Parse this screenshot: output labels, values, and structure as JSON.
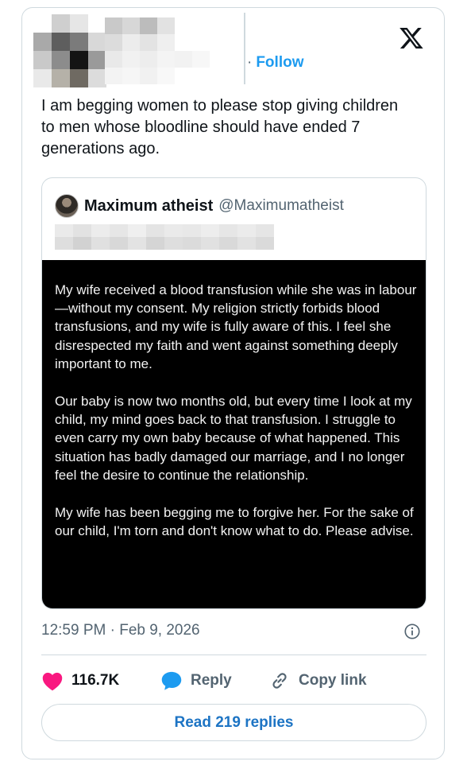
{
  "follow_label": "Follow",
  "tweet_text": "I am begging women to please stop giving children to men whose bloodline should have ended 7 generations ago.",
  "quote": {
    "name": "Maximum atheist",
    "handle": "@Maximumatheist",
    "image_paragraphs": [
      "My wife received a blood transfusion while she was in labour—without my consent. My religion strictly forbids blood transfusions, and my wife is fully aware of this. I feel she disrespected my faith and went against something deeply important to me.",
      "Our baby is now two months old, but every time I look at my child, my mind goes back to that transfusion. I struggle to even carry my own baby because of what happened. This situation has badly damaged our marriage, and I no longer feel the desire to continue the relationship.",
      "My wife has been begging me to forgive her. For the sake of our child, I'm torn and don't know what to do. Please advise."
    ]
  },
  "timestamp": "12:59 PM · Feb 9, 2026",
  "actions": {
    "like_count": "116.7K",
    "reply_label": "Reply",
    "copy_link_label": "Copy link"
  },
  "read_replies_label": "Read 219 replies",
  "icons": {
    "logo": "x-logo-icon",
    "like": "heart-icon",
    "reply": "speech-bubble-icon",
    "copy": "link-icon",
    "info": "info-icon"
  },
  "colors": {
    "accent": "#1d9bf0",
    "like": "#f91880",
    "secondary_text": "#536471",
    "border": "#cfd9de"
  }
}
